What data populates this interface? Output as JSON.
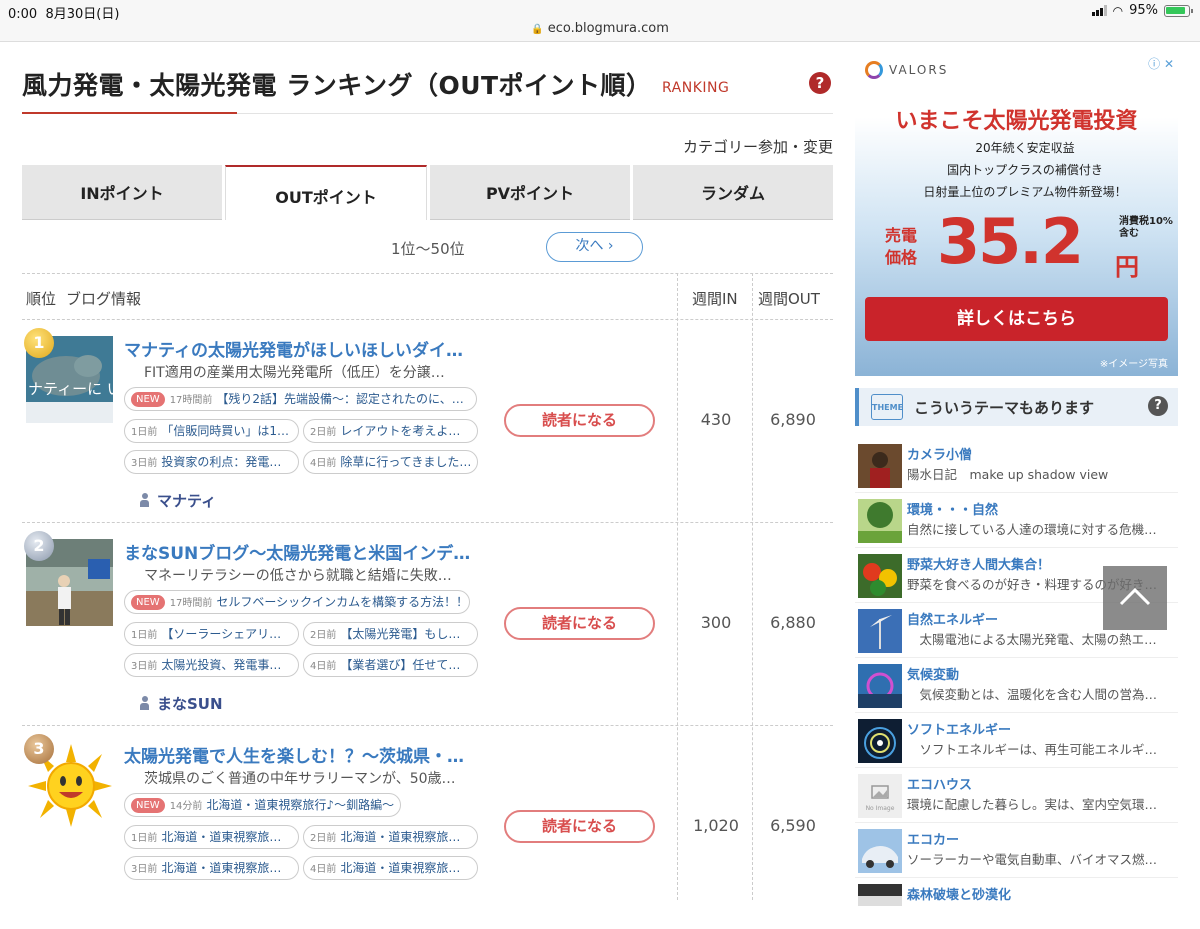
{
  "status_bar": {
    "time": "0:00",
    "date": "8月30日(日)",
    "url": "eco.blogmura.com",
    "battery": "95%"
  },
  "header": {
    "title": "風力発電・太陽光発電 ランキング（OUTポイント順）",
    "ranking_label": "RANKING",
    "help": "?",
    "category_link": "カテゴリー参加・変更"
  },
  "tabs": [
    {
      "label": "INポイント",
      "active": false
    },
    {
      "label": "OUTポイント",
      "active": true
    },
    {
      "label": "PVポイント",
      "active": false
    },
    {
      "label": "ランダム",
      "active": false
    }
  ],
  "pager": {
    "range": "1位〜50位",
    "next": "次へ ›"
  },
  "table": {
    "col_rank": "順位",
    "col_blog": "ブログ情報",
    "col_in": "週間IN",
    "col_out": "週間OUT"
  },
  "follow_label": "読者になる",
  "new_label": "NEW",
  "rows": [
    {
      "rank": "1",
      "title": "マナティの太陽光発電がほしいほしいダイ…",
      "desc": "FIT適用の産業用太陽光発電所（低圧）を分譲…",
      "posts": [
        {
          "ago": "17時間前",
          "text": "【残り2話】先端設備〜：認定されたのに、…"
        },
        {
          "ago": "1日前",
          "text": "「信販同時買い」は1…"
        },
        {
          "ago": "2日前",
          "text": "レイアウトを考えよ…"
        },
        {
          "ago": "3日前",
          "text": "投資家の利点：発電…"
        },
        {
          "ago": "4日前",
          "text": "除草に行ってきました…"
        }
      ],
      "author": "マナティ",
      "week_in": "430",
      "week_out": "6,890"
    },
    {
      "rank": "2",
      "title": "まなSUNブログ〜太陽光発電と米国インデ…",
      "desc": "マネーリテラシーの低さから就職と結婚に失敗…",
      "posts": [
        {
          "ago": "17時間前",
          "text": "セルフベーシックインカムを構築する方法！！"
        },
        {
          "ago": "1日前",
          "text": "【ソーラーシェアリ…"
        },
        {
          "ago": "2日前",
          "text": "【太陽光発電】もし…"
        },
        {
          "ago": "3日前",
          "text": "太陽光投資、発電事…"
        },
        {
          "ago": "4日前",
          "text": "【業者選び】任せて…"
        }
      ],
      "author": "まなSUN",
      "week_in": "300",
      "week_out": "6,880"
    },
    {
      "rank": "3",
      "title": "太陽光発電で人生を楽しむ！？〜茨城県・…",
      "desc": "茨城県のごく普通の中年サラリーマンが、50歳…",
      "posts": [
        {
          "ago": "14分前",
          "text": "北海道・道東視察旅行♪〜釧路編〜"
        },
        {
          "ago": "1日前",
          "text": "北海道・道東視察旅…"
        },
        {
          "ago": "2日前",
          "text": "北海道・道東視察旅…"
        },
        {
          "ago": "3日前",
          "text": "北海道・道東視察旅…"
        },
        {
          "ago": "4日前",
          "text": "北海道・道東視察旅…"
        }
      ],
      "author": "",
      "week_in": "1,020",
      "week_out": "6,590"
    }
  ],
  "thumb_texts": {
    "row1": "ナティーに いたい"
  },
  "ad": {
    "brand": "VALORS",
    "headline": "いまこそ太陽光発電投資",
    "sub1": "20年続く安定収益",
    "sub2": "国内トップクラスの補償付き",
    "sub3": "日射量上位のプレミアム物件新登場！",
    "price_label": "売電価格",
    "price": "35.2",
    "yen": "円",
    "tax": "消費税10% 含む",
    "cta": "詳しくはこちら",
    "note": "※イメージ写真"
  },
  "themes_header": {
    "title": "こういうテーマもあります",
    "icon_text": "THEME",
    "help": "?"
  },
  "themes": [
    {
      "name": "カメラ小僧",
      "desc": "陽水日記　make up shadow view"
    },
    {
      "name": "環境・・・自然",
      "desc": "自然に接している人達の環境に対する危機…"
    },
    {
      "name": "野菜大好き人間大集合！",
      "desc": "野菜を食べるのが好き・料理するのが好き…"
    },
    {
      "name": "自然エネルギー",
      "desc": "　太陽電池による太陽光発電、太陽の熱エ…"
    },
    {
      "name": "気候変動",
      "desc": "　気候変動とは、温暖化を含む人間の営為…"
    },
    {
      "name": "ソフトエネルギー",
      "desc": "　ソフトエネルギーは、再生可能エネルギ…"
    },
    {
      "name": "エコハウス",
      "desc": "環境に配慮した暮らし。実は、室内空気環…"
    },
    {
      "name": "エコカー",
      "desc": "ソーラーカーや電気自動車、バイオマス燃…"
    },
    {
      "name": "森林破壊と砂漠化",
      "desc": ""
    }
  ],
  "theme_img_texts": {
    "no_image": "No Image"
  },
  "colors": {
    "accent_red": "#b02a2a",
    "link_blue": "#3a7abf",
    "follow_red": "#d84e4e"
  }
}
